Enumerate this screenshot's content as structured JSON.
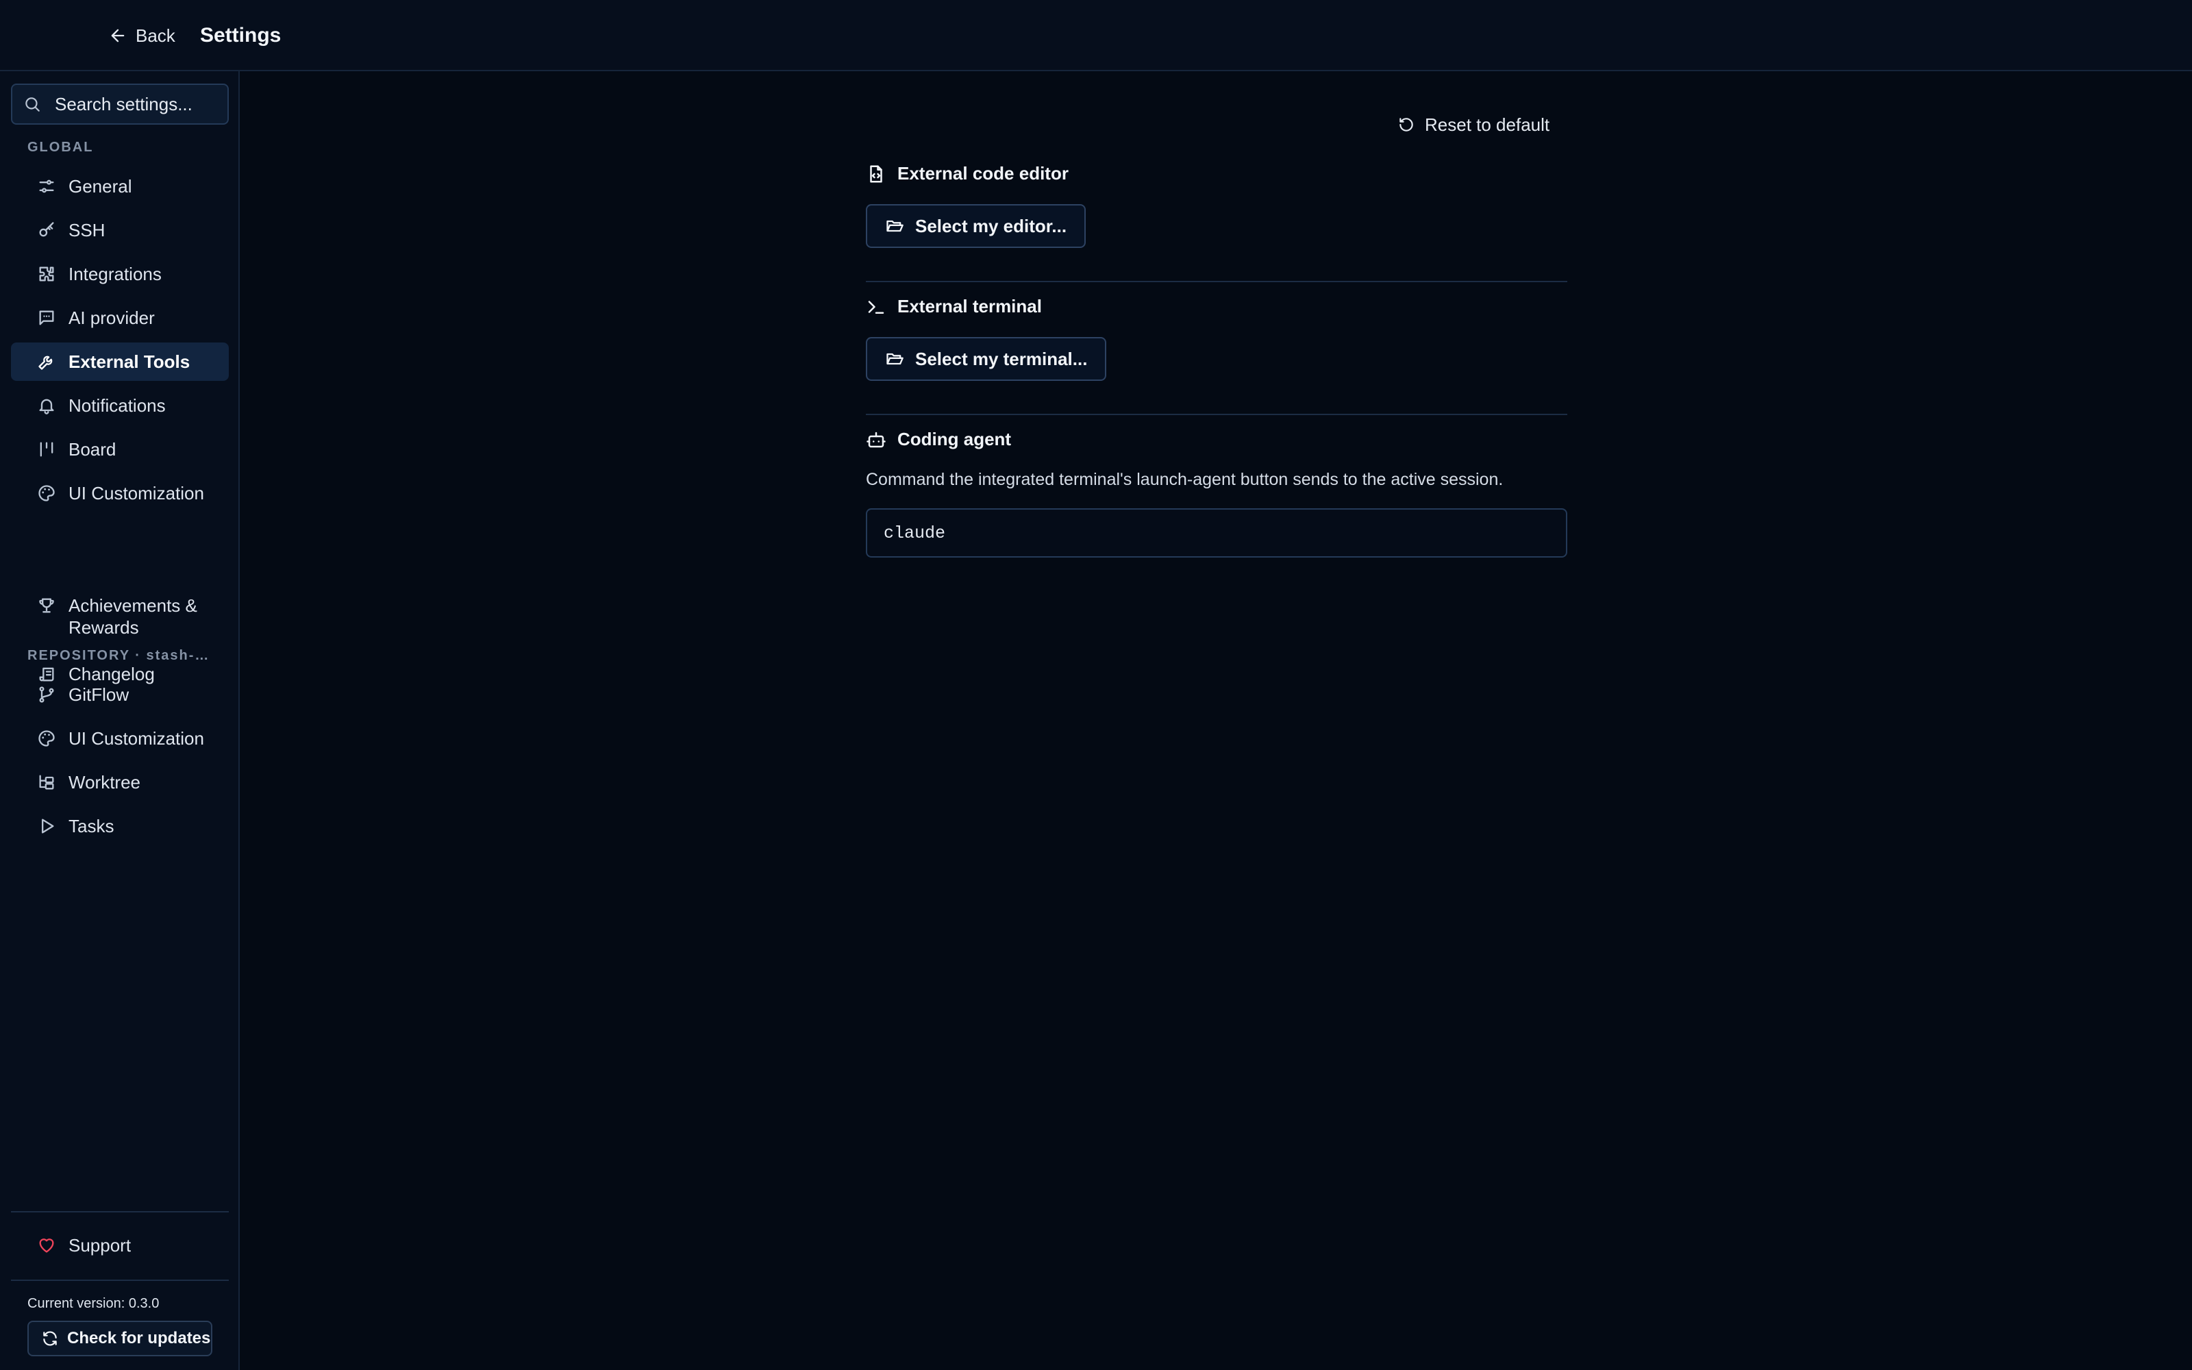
{
  "header": {
    "back_label": "Back",
    "title": "Settings"
  },
  "sidebar": {
    "search_placeholder": "Search settings...",
    "global_label": "GLOBAL",
    "global_items": [
      {
        "label": "General",
        "icon": "sliders-icon"
      },
      {
        "label": "SSH",
        "icon": "key-icon"
      },
      {
        "label": "Integrations",
        "icon": "puzzle-icon"
      },
      {
        "label": "AI provider",
        "icon": "message-square-icon"
      },
      {
        "label": "External Tools",
        "icon": "wrench-icon",
        "active": true
      },
      {
        "label": "Notifications",
        "icon": "bell-icon"
      },
      {
        "label": "Board",
        "icon": "kanban-icon"
      },
      {
        "label": "UI Customization",
        "icon": "palette-icon"
      },
      {
        "label": "Achievements & Rewards",
        "icon": "trophy-icon"
      },
      {
        "label": "Changelog",
        "icon": "scroll-icon"
      }
    ],
    "repo_label": "REPOSITORY · stash-st...",
    "repo_items": [
      {
        "label": "GitFlow",
        "icon": "git-branch-icon"
      },
      {
        "label": "UI Customization",
        "icon": "palette-icon"
      },
      {
        "label": "Worktree",
        "icon": "folder-tree-icon"
      },
      {
        "label": "Tasks",
        "icon": "play-icon"
      }
    ],
    "support_label": "Support",
    "version_text": "Current version: 0.3.0",
    "update_label": "Check for updates"
  },
  "main": {
    "reset_label": "Reset to default",
    "editor": {
      "title": "External code editor",
      "button": "Select my editor..."
    },
    "terminal": {
      "title": "External terminal",
      "button": "Select my terminal..."
    },
    "agent": {
      "title": "Coding agent",
      "description": "Command the integrated terminal's launch-agent button sends to the active session.",
      "value": "claude"
    }
  },
  "colors": {
    "background": "#040a14",
    "sidebar_active": "#122540",
    "support_heart": "#f0445a"
  }
}
